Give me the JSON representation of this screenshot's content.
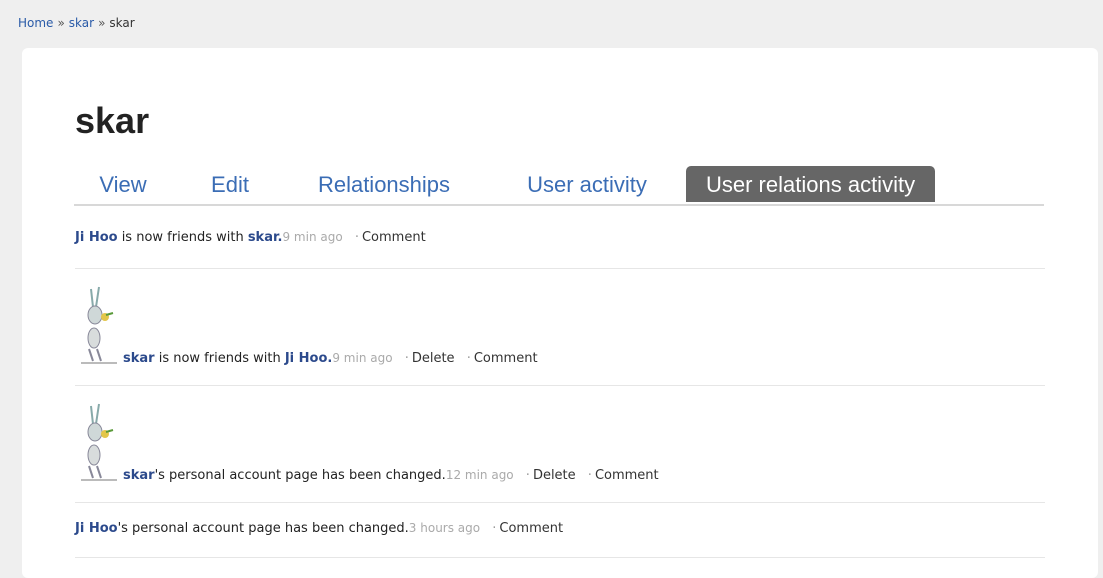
{
  "breadcrumb": {
    "home": "Home",
    "sep": "»",
    "parent": "skar",
    "current": "skar"
  },
  "page": {
    "title": "skar"
  },
  "tabs": [
    {
      "label": "View"
    },
    {
      "label": "Edit"
    },
    {
      "label": "Relationships"
    },
    {
      "label": "User activity"
    },
    {
      "label": "User relations activity",
      "active": true
    }
  ],
  "feed": [
    {
      "user": "Ji Hoo",
      "text": " is now friends with ",
      "target": "skar",
      "end": ".",
      "time": "9 min ago",
      "actions": [
        "Comment"
      ],
      "avatar": false
    },
    {
      "user": "skar",
      "text": " is now friends with ",
      "target": "Ji Hoo",
      "end": ".",
      "time": "9 min ago",
      "actions": [
        "Delete",
        "Comment"
      ],
      "avatar": true
    },
    {
      "user": "skar",
      "text": "'s personal account page has been changed.",
      "time": "12 min ago",
      "actions": [
        "Delete",
        "Comment"
      ],
      "avatar": true
    },
    {
      "user": "Ji Hoo",
      "text": "'s personal account page has been changed.",
      "time": "3 hours ago",
      "actions": [
        "Comment"
      ],
      "avatar": false
    }
  ]
}
